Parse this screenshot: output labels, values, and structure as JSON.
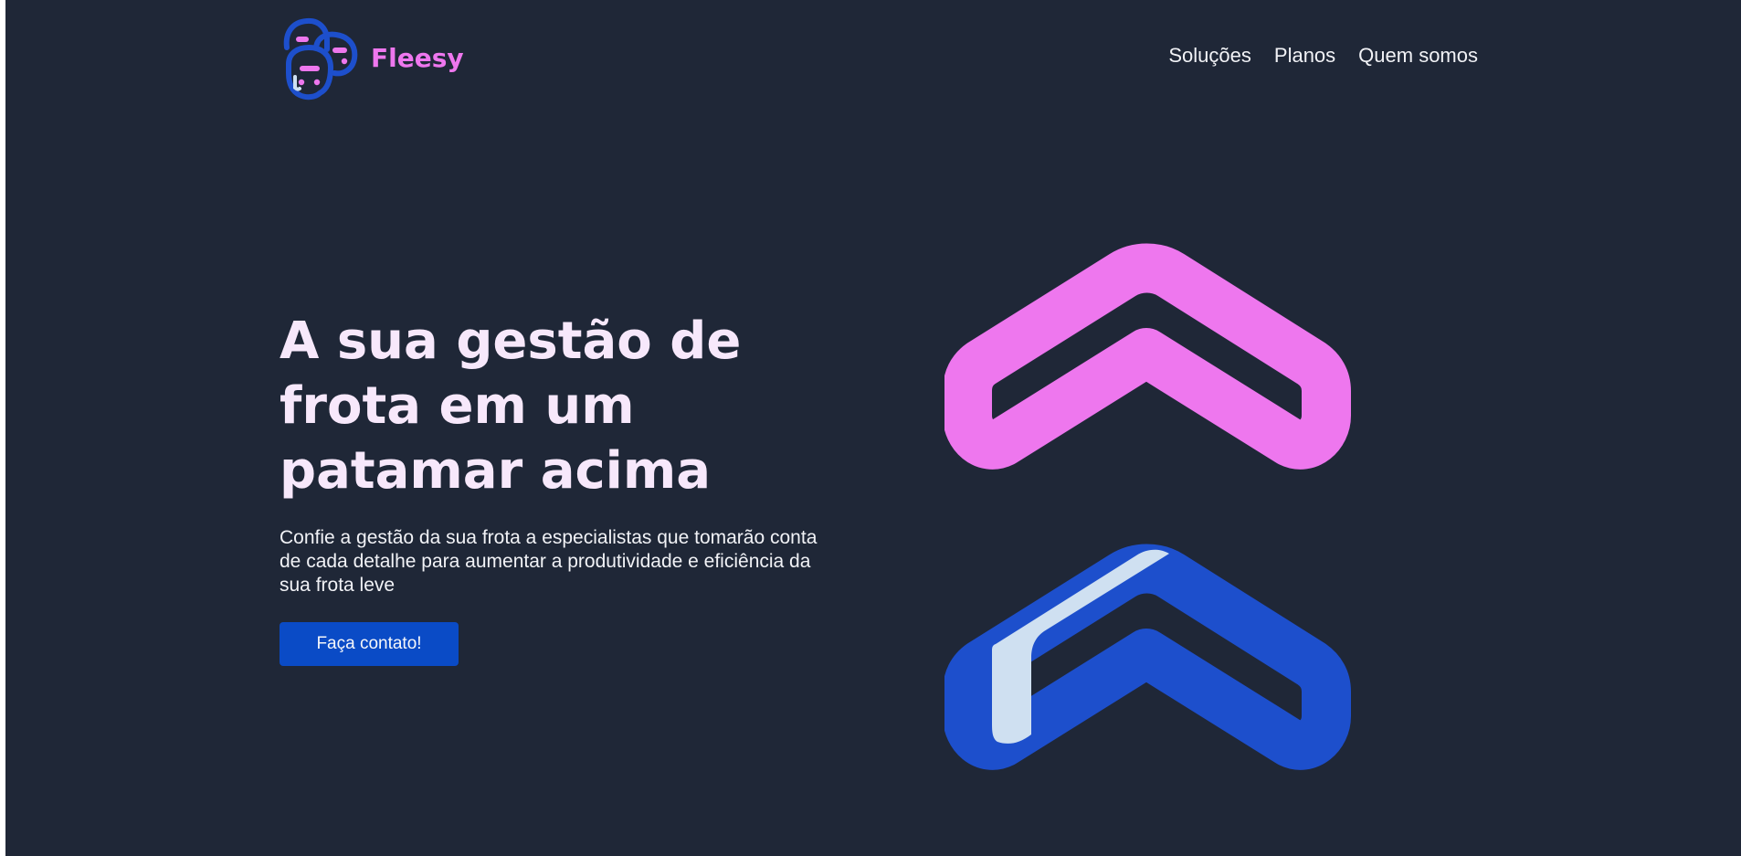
{
  "brand": {
    "name": "Fleesy",
    "logo_icon": "cars-logo-icon"
  },
  "nav": {
    "items": [
      {
        "label": "Soluções"
      },
      {
        "label": "Planos"
      },
      {
        "label": "Quem somos"
      }
    ]
  },
  "hero": {
    "title": "A sua gestão de frota em um patamar acima",
    "subtitle": "Confie a gestão da sua frota a especialistas que tomarão conta de cada detalhe para aumentar a produtividade e eficiência da sua frota leve",
    "cta_label": "Faça contato!",
    "art_icon": "double-chevron-up-icon"
  },
  "colors": {
    "background": "#1f2737",
    "accent_pink": "#ee77ee",
    "accent_blue": "#1d4fcc",
    "button": "#0a4bc6",
    "highlight": "#cfe0f1"
  }
}
